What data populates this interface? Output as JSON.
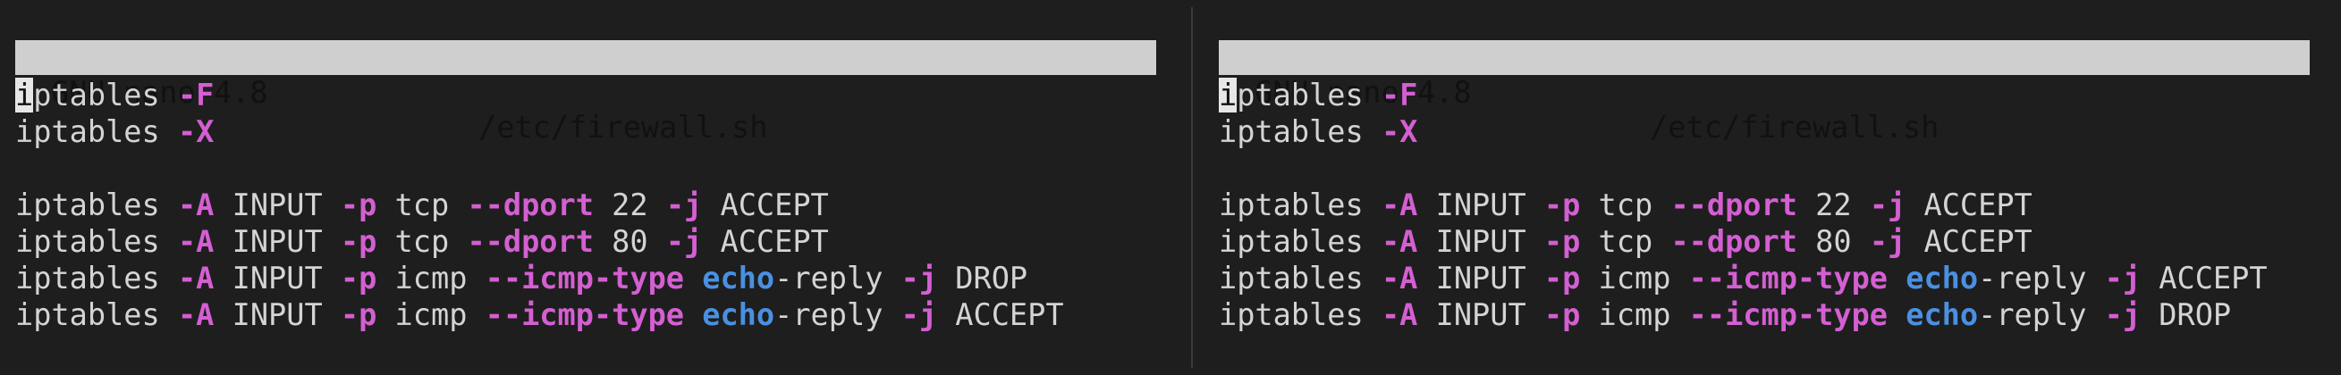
{
  "left_pane": {
    "title": {
      "app": "GNU nano 4.8",
      "file": "/etc/firewall.sh"
    },
    "lines": [
      [
        {
          "t": "i",
          "c": "cursor"
        },
        {
          "t": "ptables "
        },
        {
          "t": "-F",
          "c": "flag"
        }
      ],
      [
        {
          "t": "iptables "
        },
        {
          "t": "-X",
          "c": "flag"
        }
      ],
      [],
      [
        {
          "t": "iptables "
        },
        {
          "t": "-A",
          "c": "flag"
        },
        {
          "t": " INPUT "
        },
        {
          "t": "-p",
          "c": "flag"
        },
        {
          "t": " tcp "
        },
        {
          "t": "--dport",
          "c": "flag"
        },
        {
          "t": " 22 "
        },
        {
          "t": "-j",
          "c": "flag"
        },
        {
          "t": " ACCEPT"
        }
      ],
      [
        {
          "t": "iptables "
        },
        {
          "t": "-A",
          "c": "flag"
        },
        {
          "t": " INPUT "
        },
        {
          "t": "-p",
          "c": "flag"
        },
        {
          "t": " tcp "
        },
        {
          "t": "--dport",
          "c": "flag"
        },
        {
          "t": " 80 "
        },
        {
          "t": "-j",
          "c": "flag"
        },
        {
          "t": " ACCEPT"
        }
      ],
      [
        {
          "t": "iptables "
        },
        {
          "t": "-A",
          "c": "flag"
        },
        {
          "t": " INPUT "
        },
        {
          "t": "-p",
          "c": "flag"
        },
        {
          "t": " icmp "
        },
        {
          "t": "--icmp-type",
          "c": "flag"
        },
        {
          "t": " "
        },
        {
          "t": "echo",
          "c": "kw"
        },
        {
          "t": "-reply "
        },
        {
          "t": "-j",
          "c": "flag"
        },
        {
          "t": " DROP"
        }
      ],
      [
        {
          "t": "iptables "
        },
        {
          "t": "-A",
          "c": "flag"
        },
        {
          "t": " INPUT "
        },
        {
          "t": "-p",
          "c": "flag"
        },
        {
          "t": " icmp "
        },
        {
          "t": "--icmp-type",
          "c": "flag"
        },
        {
          "t": " "
        },
        {
          "t": "echo",
          "c": "kw"
        },
        {
          "t": "-reply "
        },
        {
          "t": "-j",
          "c": "flag"
        },
        {
          "t": " ACCEPT"
        }
      ]
    ]
  },
  "right_pane": {
    "title": {
      "app": "GNU nano 4.8",
      "file": "/etc/firewall.sh"
    },
    "lines": [
      [
        {
          "t": "i",
          "c": "cursor"
        },
        {
          "t": "ptables "
        },
        {
          "t": "-F",
          "c": "flag"
        }
      ],
      [
        {
          "t": "iptables "
        },
        {
          "t": "-X",
          "c": "flag"
        }
      ],
      [],
      [
        {
          "t": "iptables "
        },
        {
          "t": "-A",
          "c": "flag"
        },
        {
          "t": " INPUT "
        },
        {
          "t": "-p",
          "c": "flag"
        },
        {
          "t": " tcp "
        },
        {
          "t": "--dport",
          "c": "flag"
        },
        {
          "t": " 22 "
        },
        {
          "t": "-j",
          "c": "flag"
        },
        {
          "t": " ACCEPT"
        }
      ],
      [
        {
          "t": "iptables "
        },
        {
          "t": "-A",
          "c": "flag"
        },
        {
          "t": " INPUT "
        },
        {
          "t": "-p",
          "c": "flag"
        },
        {
          "t": " tcp "
        },
        {
          "t": "--dport",
          "c": "flag"
        },
        {
          "t": " 80 "
        },
        {
          "t": "-j",
          "c": "flag"
        },
        {
          "t": " ACCEPT"
        }
      ],
      [
        {
          "t": "iptables "
        },
        {
          "t": "-A",
          "c": "flag"
        },
        {
          "t": " INPUT "
        },
        {
          "t": "-p",
          "c": "flag"
        },
        {
          "t": " icmp "
        },
        {
          "t": "--icmp-type",
          "c": "flag"
        },
        {
          "t": " "
        },
        {
          "t": "echo",
          "c": "kw"
        },
        {
          "t": "-reply "
        },
        {
          "t": "-j",
          "c": "flag"
        },
        {
          "t": " ACCEPT"
        }
      ],
      [
        {
          "t": "iptables "
        },
        {
          "t": "-A",
          "c": "flag"
        },
        {
          "t": " INPUT "
        },
        {
          "t": "-p",
          "c": "flag"
        },
        {
          "t": " icmp "
        },
        {
          "t": "--icmp-type",
          "c": "flag"
        },
        {
          "t": " "
        },
        {
          "t": "echo",
          "c": "kw"
        },
        {
          "t": "-reply "
        },
        {
          "t": "-j",
          "c": "flag"
        },
        {
          "t": " DROP"
        }
      ]
    ]
  },
  "colors": {
    "background": "#1e1e1e",
    "text": "#d4d4d4",
    "titlebar_bg": "#cfcfcf",
    "flag": "#d45fd2",
    "keyword": "#4a90e2"
  }
}
